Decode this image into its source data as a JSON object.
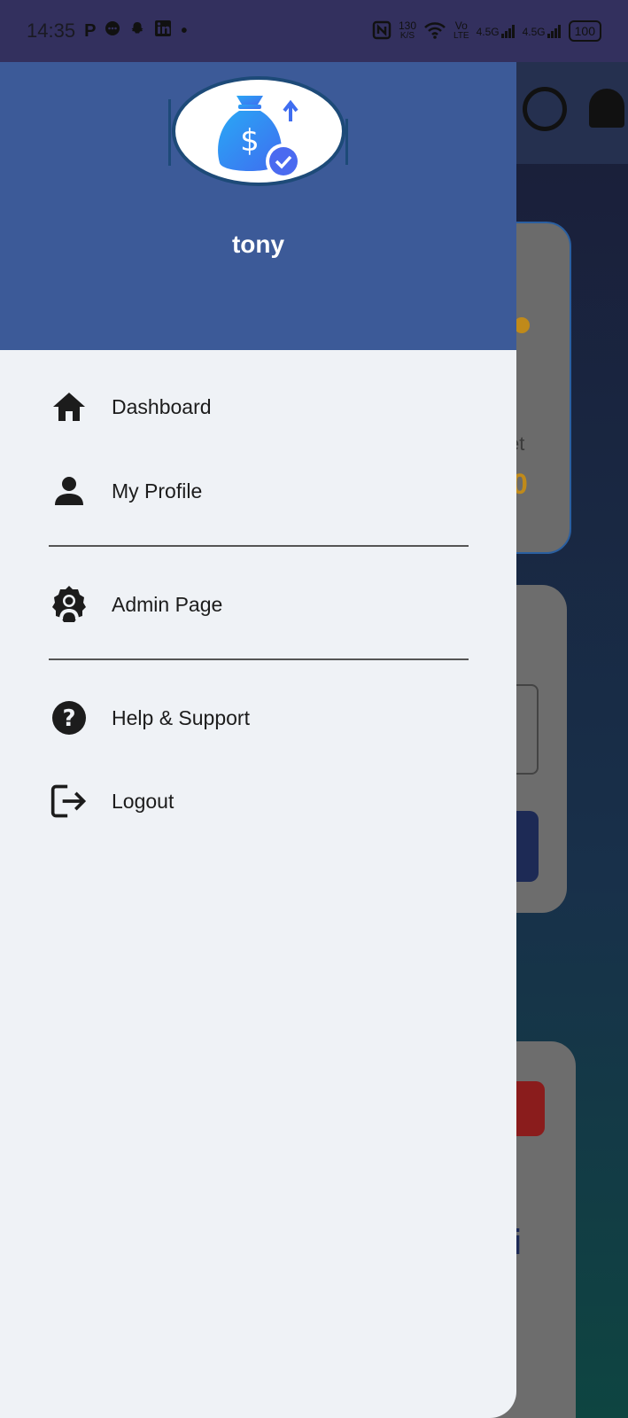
{
  "status_bar": {
    "time": "14:35",
    "icons": [
      "P",
      "chat-icon",
      "snapchat-icon",
      "linkedin-icon",
      "dot"
    ],
    "net_speed_top": "130",
    "net_speed_bottom": "K/S",
    "volte_top": "Vo",
    "volte_bottom": "LTE",
    "signal1": "4.5G",
    "signal2": "4.5G",
    "battery": "100"
  },
  "background": {
    "text_et": "et",
    "text_yellow": "0",
    "text_i": "i"
  },
  "drawer": {
    "user_name": "tony",
    "items": [
      {
        "label": "Dashboard",
        "icon": "home-icon"
      },
      {
        "label": "My Profile",
        "icon": "person-icon"
      },
      {
        "label": "Admin Page",
        "icon": "admin-gear-icon"
      },
      {
        "label": "Help & Support",
        "icon": "help-circle-icon"
      },
      {
        "label": "Logout",
        "icon": "logout-icon"
      }
    ]
  },
  "colors": {
    "drawer_header": "#3c5a98",
    "drawer_bg": "#eff2f6",
    "status_bar": "#33305e"
  }
}
